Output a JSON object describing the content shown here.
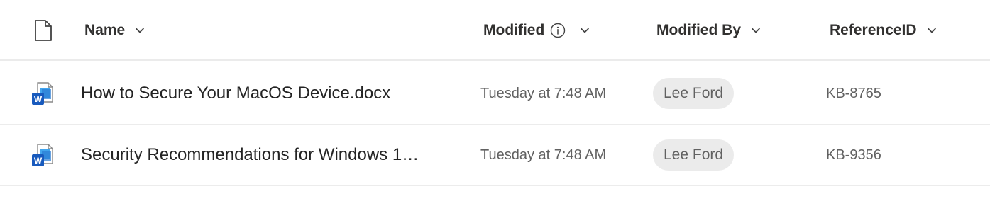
{
  "header": {
    "name": "Name",
    "modified": "Modified",
    "modified_by": "Modified By",
    "reference_id": "ReferenceID",
    "type_icon": "file-icon",
    "info_icon": "info-icon",
    "sort_icon": "chevron-down-icon"
  },
  "rows": [
    {
      "icon": "word-document-icon",
      "name": "How to Secure Your MacOS Device.docx",
      "modified": "Tuesday at 7:48 AM",
      "modified_by": "Lee Ford",
      "reference_id": "KB-8765"
    },
    {
      "icon": "word-document-icon",
      "name": "Security Recommendations for Windows 1…",
      "modified": "Tuesday at 7:48 AM",
      "modified_by": "Lee Ford",
      "reference_id": "KB-9356"
    }
  ],
  "colors": {
    "word_blue": "#185abd",
    "pill_bg": "#ebebeb",
    "secondary_text": "#616161",
    "divider": "#ebebeb"
  }
}
